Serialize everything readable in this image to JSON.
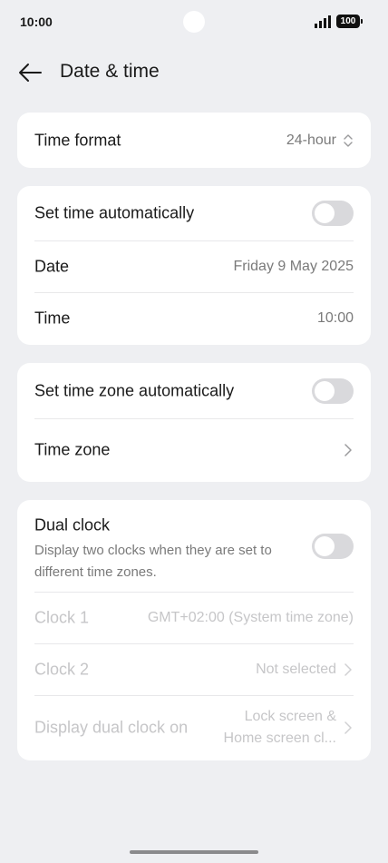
{
  "status": {
    "time": "10:00",
    "battery": "100"
  },
  "header": {
    "title": "Date & time"
  },
  "time_format": {
    "label": "Time format",
    "value": "24-hour"
  },
  "auto_time": {
    "label": "Set time automatically",
    "enabled": false,
    "date_label": "Date",
    "date_value": "Friday 9 May 2025",
    "time_label": "Time",
    "time_value": "10:00"
  },
  "timezone": {
    "auto_label": "Set time zone automatically",
    "auto_enabled": false,
    "zone_label": "Time zone"
  },
  "dual_clock": {
    "label": "Dual clock",
    "description": "Display two clocks when they are set to different time zones.",
    "enabled": false,
    "clock1_label": "Clock 1",
    "clock1_value": "GMT+02:00 (System time zone)",
    "clock2_label": "Clock 2",
    "clock2_value": "Not selected",
    "display_on_label": "Display dual clock on",
    "display_on_value_line1": "Lock screen &",
    "display_on_value_line2": "Home screen cl..."
  }
}
